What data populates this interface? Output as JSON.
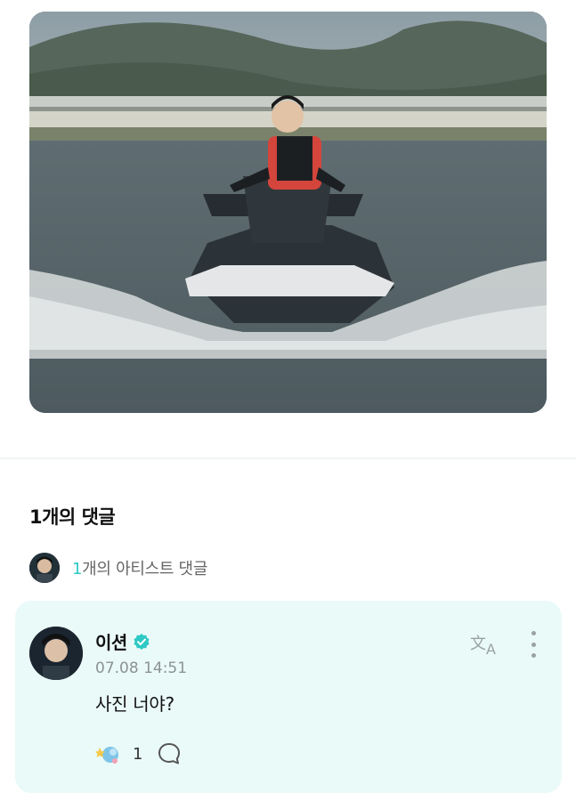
{
  "post": {
    "image_alt": ""
  },
  "comments": {
    "title": "1개의 댓글",
    "artist_summary": {
      "count": "1",
      "label": "개의 아티스트 댓글"
    },
    "items": [
      {
        "author": "이션",
        "timestamp": "07.08 14:51",
        "text": "사진 너야?",
        "like_count": "1",
        "verified": true
      }
    ]
  },
  "colors": {
    "accent": "#2ec9c4",
    "card_background": "#eafaf8",
    "verified_badge": "#2ec9c4"
  },
  "icons": {
    "translate": "translate-icon",
    "more": "more-vertical-icon",
    "reaction": "reaction-icon",
    "reply": "reply-bubble-icon",
    "verified": "verified-badge-icon"
  }
}
